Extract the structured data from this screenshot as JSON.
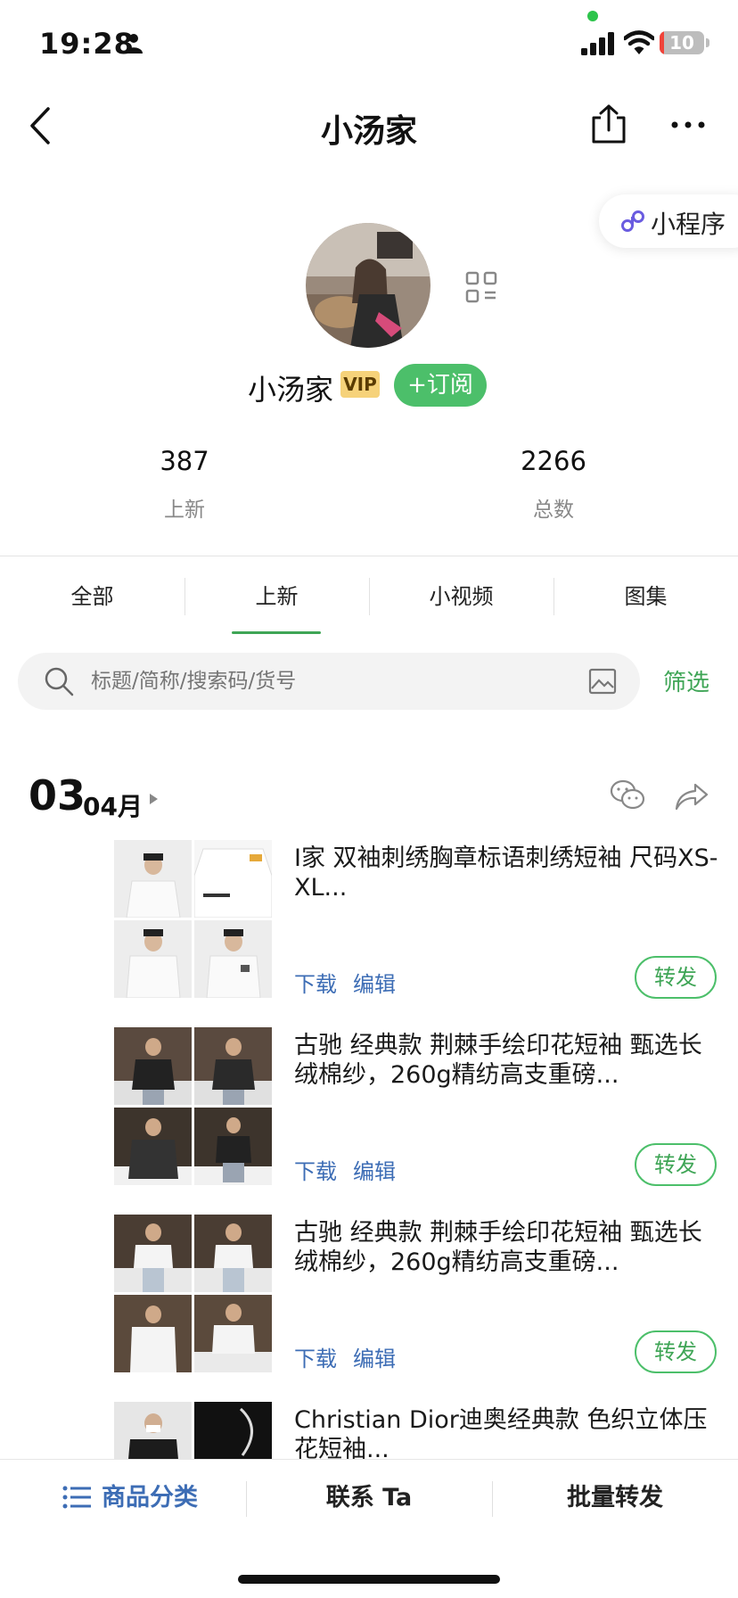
{
  "status_bar": {
    "time": "19:28",
    "battery_level": "10",
    "battery_fill_fraction": 0.1,
    "battery_color": "#f0443a"
  },
  "nav": {
    "title": "小汤家"
  },
  "mini_program": {
    "label": "小程序"
  },
  "profile": {
    "name": "小汤家",
    "vip_label": "VIP",
    "subscribe_label": "+订阅",
    "stats": [
      {
        "value": "387",
        "label": "上新"
      },
      {
        "value": "2266",
        "label": "总数"
      }
    ]
  },
  "tabs": [
    {
      "label": "全部",
      "active": false
    },
    {
      "label": "上新",
      "active": true
    },
    {
      "label": "小视频",
      "active": false
    },
    {
      "label": "图集",
      "active": false
    }
  ],
  "search": {
    "placeholder": "标题/简称/搜索码/货号",
    "filter_label": "筛选"
  },
  "date_group": {
    "day": "03",
    "month": "04月"
  },
  "products": [
    {
      "title": "I家 双袖刺绣胸章标语刺绣短袖 尺码XS-XL...",
      "download": "下载",
      "edit": "编辑",
      "repost": "转发"
    },
    {
      "title": "古驰 经典款 荆棘手绘印花短袖 甄选长绒棉纱，260g精纺高支重磅...",
      "download": "下载",
      "edit": "编辑",
      "repost": "转发"
    },
    {
      "title": "古驰 经典款 荆棘手绘印花短袖 甄选长绒棉纱，260g精纺高支重磅...",
      "download": "下载",
      "edit": "编辑",
      "repost": "转发"
    },
    {
      "title": "Christian Dior迪奥经典款 色织立体压花短袖...",
      "download": "",
      "edit": "",
      "repost": ""
    }
  ],
  "bottom_bar": {
    "category": "商品分类",
    "contact": "联系 Ta",
    "bulk_repost": "批量转发"
  },
  "colors": {
    "accent_green": "#3fa556",
    "link_blue": "#3d6db5",
    "vip_gold": "#f6d27a"
  },
  "icons": [
    "person-icon",
    "signal-icon",
    "wifi-icon",
    "back-icon",
    "share-icon",
    "more-icon",
    "mini-program-icon",
    "qr-code-icon",
    "search-icon",
    "image-search-icon",
    "wechat-icon",
    "forward-icon",
    "list-icon"
  ]
}
